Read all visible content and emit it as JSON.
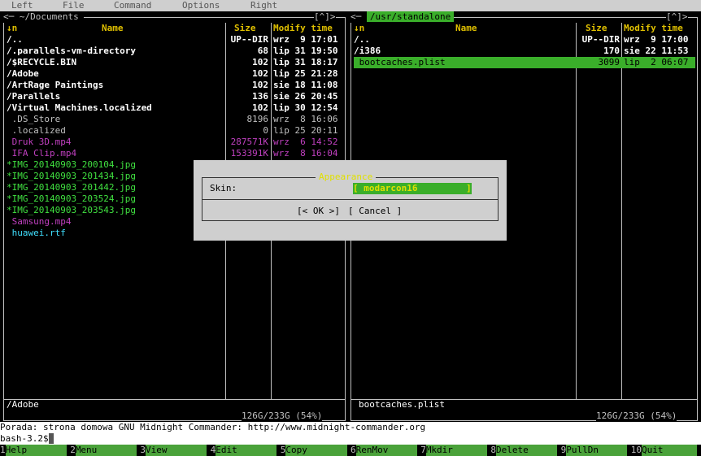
{
  "menubar": [
    "Left",
    "File",
    "Command",
    "Options",
    "Right"
  ],
  "left_panel": {
    "path": "~/Documents",
    "corner": "[^]>",
    "col_n": "↓n",
    "col_name": "Name",
    "col_size": "Size",
    "col_modify": "Modify time",
    "rows": [
      {
        "name": "/..",
        "size": "UP--DIR",
        "date": "wrz  9 17:01",
        "cls": "dir"
      },
      {
        "name": "/.parallels-vm-directory",
        "size": "68",
        "date": "lip 31 19:50",
        "cls": "dir"
      },
      {
        "name": "/$RECYCLE.BIN",
        "size": "102",
        "date": "lip 31 18:17",
        "cls": "dir"
      },
      {
        "name": "/Adobe",
        "size": "102",
        "date": "lip 25 21:28",
        "cls": "dir"
      },
      {
        "name": "/ArtRage Paintings",
        "size": "102",
        "date": "sie 18 11:08",
        "cls": "dir"
      },
      {
        "name": "/Parallels",
        "size": "136",
        "date": "sie 26 20:45",
        "cls": "dir"
      },
      {
        "name": "/Virtual Machines.localized",
        "size": "102",
        "date": "lip 30 12:54",
        "cls": "dir"
      },
      {
        "name": " .DS_Store",
        "size": "8196",
        "date": "wrz  8 16:06",
        "cls": "plain"
      },
      {
        "name": " .localized",
        "size": "0",
        "date": "lip 25 20:11",
        "cls": "plain"
      },
      {
        "name": " Druk 3D.mp4",
        "size": "287571K",
        "date": "wrz  6 14:52",
        "cls": "media"
      },
      {
        "name": " IFA Clip.mp4",
        "size": "153391K",
        "date": "wrz  8 16:04",
        "cls": "media"
      },
      {
        "name": "*IMG_20140903_200104.jpg",
        "size": "",
        "date": "",
        "cls": "exec"
      },
      {
        "name": "*IMG_20140903_201434.jpg",
        "size": "",
        "date": "",
        "cls": "exec"
      },
      {
        "name": "*IMG_20140903_201442.jpg",
        "size": "",
        "date": "",
        "cls": "exec"
      },
      {
        "name": "*IMG_20140903_203524.jpg",
        "size": "",
        "date": "",
        "cls": "exec"
      },
      {
        "name": "*IMG_20140903_203543.jpg",
        "size": "",
        "date": "",
        "cls": "exec"
      },
      {
        "name": " Samsung.mp4",
        "size": "",
        "date": "",
        "cls": "media"
      },
      {
        "name": " huawei.rtf",
        "size": "",
        "date": "",
        "cls": "doc"
      }
    ],
    "mini_status": "/Adobe",
    "disk": "126G/233G (54%)"
  },
  "right_panel": {
    "path": "/usr/standalone",
    "corner": "[^]>",
    "col_n": "↓n",
    "col_name": "Name",
    "col_size": "Size",
    "col_modify": "Modify time",
    "rows": [
      {
        "name": "/..",
        "size": "UP--DIR",
        "date": "wrz  9 17:00",
        "cls": "dir"
      },
      {
        "name": "/i386",
        "size": "170",
        "date": "sie 22 11:53",
        "cls": "dir"
      },
      {
        "name": " bootcaches.plist",
        "size": "3099",
        "date": "lip  2 06:07",
        "cls": "sel"
      }
    ],
    "mini_status": "bootcaches.plist",
    "disk": "126G/233G (54%)"
  },
  "dialog": {
    "title": "Appearance",
    "skin_label": "Skin:",
    "skin_value": "[ modarcon16         ]",
    "ok": "[< OK >]",
    "cancel": "[ Cancel ]"
  },
  "hint": "Porada: strona domowa GNU Midnight Commander: http://www.midnight-commander.org",
  "prompt": "bash-3.2$",
  "fkeys": [
    {
      "n": "1",
      "l": "Help"
    },
    {
      "n": "2",
      "l": "Menu"
    },
    {
      "n": "3",
      "l": "View"
    },
    {
      "n": "4",
      "l": "Edit"
    },
    {
      "n": "5",
      "l": "Copy"
    },
    {
      "n": "6",
      "l": "RenMov"
    },
    {
      "n": "7",
      "l": "Mkdir"
    },
    {
      "n": "8",
      "l": "Delete"
    },
    {
      "n": "9",
      "l": "PullDn"
    },
    {
      "n": "10",
      "l": "Quit"
    }
  ]
}
